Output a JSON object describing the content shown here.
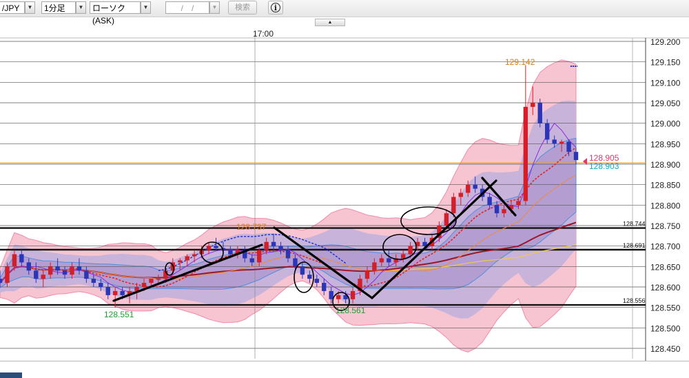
{
  "toolbar": {
    "pair": "/JPY",
    "timeframe": "1分足",
    "chart_type": "ローソク(ASK)",
    "date_value": "/　/",
    "search_label": "検索",
    "info_glyph": "i"
  },
  "chart_data": {
    "type": "candlestick",
    "time_label": "17:00",
    "y_ticks": [
      "129.200",
      "129.150",
      "129.100",
      "129.050",
      "129.000",
      "128.950",
      "128.900",
      "128.850",
      "128.800",
      "128.750",
      "128.700",
      "128.650",
      "128.600",
      "128.550",
      "128.500",
      "128.450"
    ],
    "ylim": [
      128.43,
      129.21
    ],
    "bottom_clipped_tick": "129.200",
    "annotations": {
      "high_label": "129.142",
      "mid_high_label": "128.737",
      "low_label_1": "128.551",
      "low_label_2": "128.561",
      "bid_price": "128.905",
      "ask_price": "128.903",
      "line_744": "128.744",
      "line_691": "128.691",
      "line_556": "128.556"
    },
    "horizontal_lines": [
      128.744,
      128.691,
      128.556
    ],
    "orange_line": 128.903,
    "candles": [
      [
        128.62,
        128.64,
        128.6,
        128.61
      ],
      [
        128.61,
        128.66,
        128.6,
        128.65
      ],
      [
        128.65,
        128.69,
        128.64,
        128.68
      ],
      [
        128.68,
        128.69,
        128.65,
        128.66
      ],
      [
        128.66,
        128.67,
        128.63,
        128.64
      ],
      [
        128.64,
        128.66,
        128.61,
        128.62
      ],
      [
        128.62,
        128.64,
        128.6,
        128.63
      ],
      [
        128.63,
        128.66,
        128.62,
        128.65
      ],
      [
        128.65,
        128.67,
        128.63,
        128.64
      ],
      [
        128.64,
        128.65,
        128.62,
        128.63
      ],
      [
        128.63,
        128.66,
        128.62,
        128.65
      ],
      [
        128.65,
        128.67,
        128.63,
        128.64
      ],
      [
        128.64,
        128.65,
        128.61,
        128.62
      ],
      [
        128.62,
        128.63,
        128.6,
        128.61
      ],
      [
        128.61,
        128.62,
        128.59,
        128.6
      ],
      [
        128.6,
        128.61,
        128.57,
        128.58
      ],
      [
        128.58,
        128.6,
        128.55,
        128.59
      ],
      [
        128.59,
        128.6,
        128.57,
        128.58
      ],
      [
        128.58,
        128.6,
        128.56,
        128.59
      ],
      [
        128.59,
        128.61,
        128.57,
        128.6
      ],
      [
        128.6,
        128.62,
        128.59,
        128.61
      ],
      [
        128.61,
        128.62,
        128.6,
        128.62
      ],
      [
        128.62,
        128.63,
        128.61,
        128.62
      ],
      [
        128.62,
        128.65,
        128.61,
        128.64
      ],
      [
        128.64,
        128.67,
        128.63,
        128.66
      ],
      [
        128.66,
        128.67,
        128.64,
        128.665
      ],
      [
        128.665,
        128.68,
        128.65,
        128.675
      ],
      [
        128.675,
        128.69,
        128.66,
        128.68
      ],
      [
        128.68,
        128.7,
        128.67,
        128.69
      ],
      [
        128.69,
        128.71,
        128.68,
        128.7
      ],
      [
        128.7,
        128.72,
        128.69,
        128.695
      ],
      [
        128.695,
        128.71,
        128.68,
        128.69
      ],
      [
        128.69,
        128.7,
        128.67,
        128.68
      ],
      [
        128.68,
        128.7,
        128.67,
        128.69
      ],
      [
        128.69,
        128.7,
        128.66,
        128.67
      ],
      [
        128.67,
        128.68,
        128.65,
        128.66
      ],
      [
        128.66,
        128.7,
        128.65,
        128.69
      ],
      [
        128.69,
        128.72,
        128.68,
        128.71
      ],
      [
        128.71,
        128.73,
        128.69,
        128.7
      ],
      [
        128.7,
        128.71,
        128.68,
        128.69
      ],
      [
        128.69,
        128.7,
        128.66,
        128.67
      ],
      [
        128.67,
        128.68,
        128.64,
        128.65
      ],
      [
        128.65,
        128.66,
        128.62,
        128.63
      ],
      [
        128.63,
        128.64,
        128.61,
        128.62
      ],
      [
        128.62,
        128.63,
        128.6,
        128.61
      ],
      [
        128.61,
        128.62,
        128.58,
        128.59
      ],
      [
        128.59,
        128.6,
        128.56,
        128.57
      ],
      [
        128.57,
        128.59,
        128.56,
        128.58
      ],
      [
        128.58,
        128.59,
        128.56,
        128.57
      ],
      [
        128.57,
        128.6,
        128.56,
        128.59
      ],
      [
        128.59,
        128.63,
        128.58,
        128.62
      ],
      [
        128.62,
        128.65,
        128.61,
        128.64
      ],
      [
        128.64,
        128.67,
        128.63,
        128.66
      ],
      [
        128.66,
        128.68,
        128.65,
        128.67
      ],
      [
        128.67,
        128.69,
        128.65,
        128.66
      ],
      [
        128.66,
        128.68,
        128.65,
        128.67
      ],
      [
        128.67,
        128.69,
        128.66,
        128.68
      ],
      [
        128.68,
        128.71,
        128.67,
        128.7
      ],
      [
        128.7,
        128.72,
        128.69,
        128.71
      ],
      [
        128.71,
        128.72,
        128.69,
        128.7
      ],
      [
        128.7,
        128.73,
        128.69,
        128.72
      ],
      [
        128.72,
        128.76,
        128.71,
        128.75
      ],
      [
        128.75,
        128.79,
        128.74,
        128.78
      ],
      [
        128.78,
        128.83,
        128.77,
        128.82
      ],
      [
        128.82,
        128.84,
        128.8,
        128.83
      ],
      [
        128.83,
        128.86,
        128.82,
        128.85
      ],
      [
        128.85,
        128.87,
        128.83,
        128.84
      ],
      [
        128.84,
        128.85,
        128.81,
        128.82
      ],
      [
        128.82,
        128.83,
        128.79,
        128.8
      ],
      [
        128.8,
        128.81,
        128.77,
        128.78
      ],
      [
        128.78,
        128.8,
        128.77,
        128.79
      ],
      [
        128.79,
        128.81,
        128.78,
        128.8
      ],
      [
        128.8,
        128.82,
        128.79,
        128.81
      ],
      [
        128.81,
        129.142,
        128.8,
        129.04
      ],
      [
        129.04,
        129.09,
        129.02,
        129.05
      ],
      [
        129.05,
        129.06,
        128.99,
        129.0
      ],
      [
        129.0,
        129.01,
        128.95,
        128.96
      ],
      [
        128.96,
        128.97,
        128.94,
        128.95
      ],
      [
        128.95,
        128.96,
        128.93,
        128.955
      ],
      [
        128.955,
        128.96,
        128.92,
        128.93
      ],
      [
        128.93,
        128.94,
        128.9,
        128.91
      ]
    ]
  }
}
